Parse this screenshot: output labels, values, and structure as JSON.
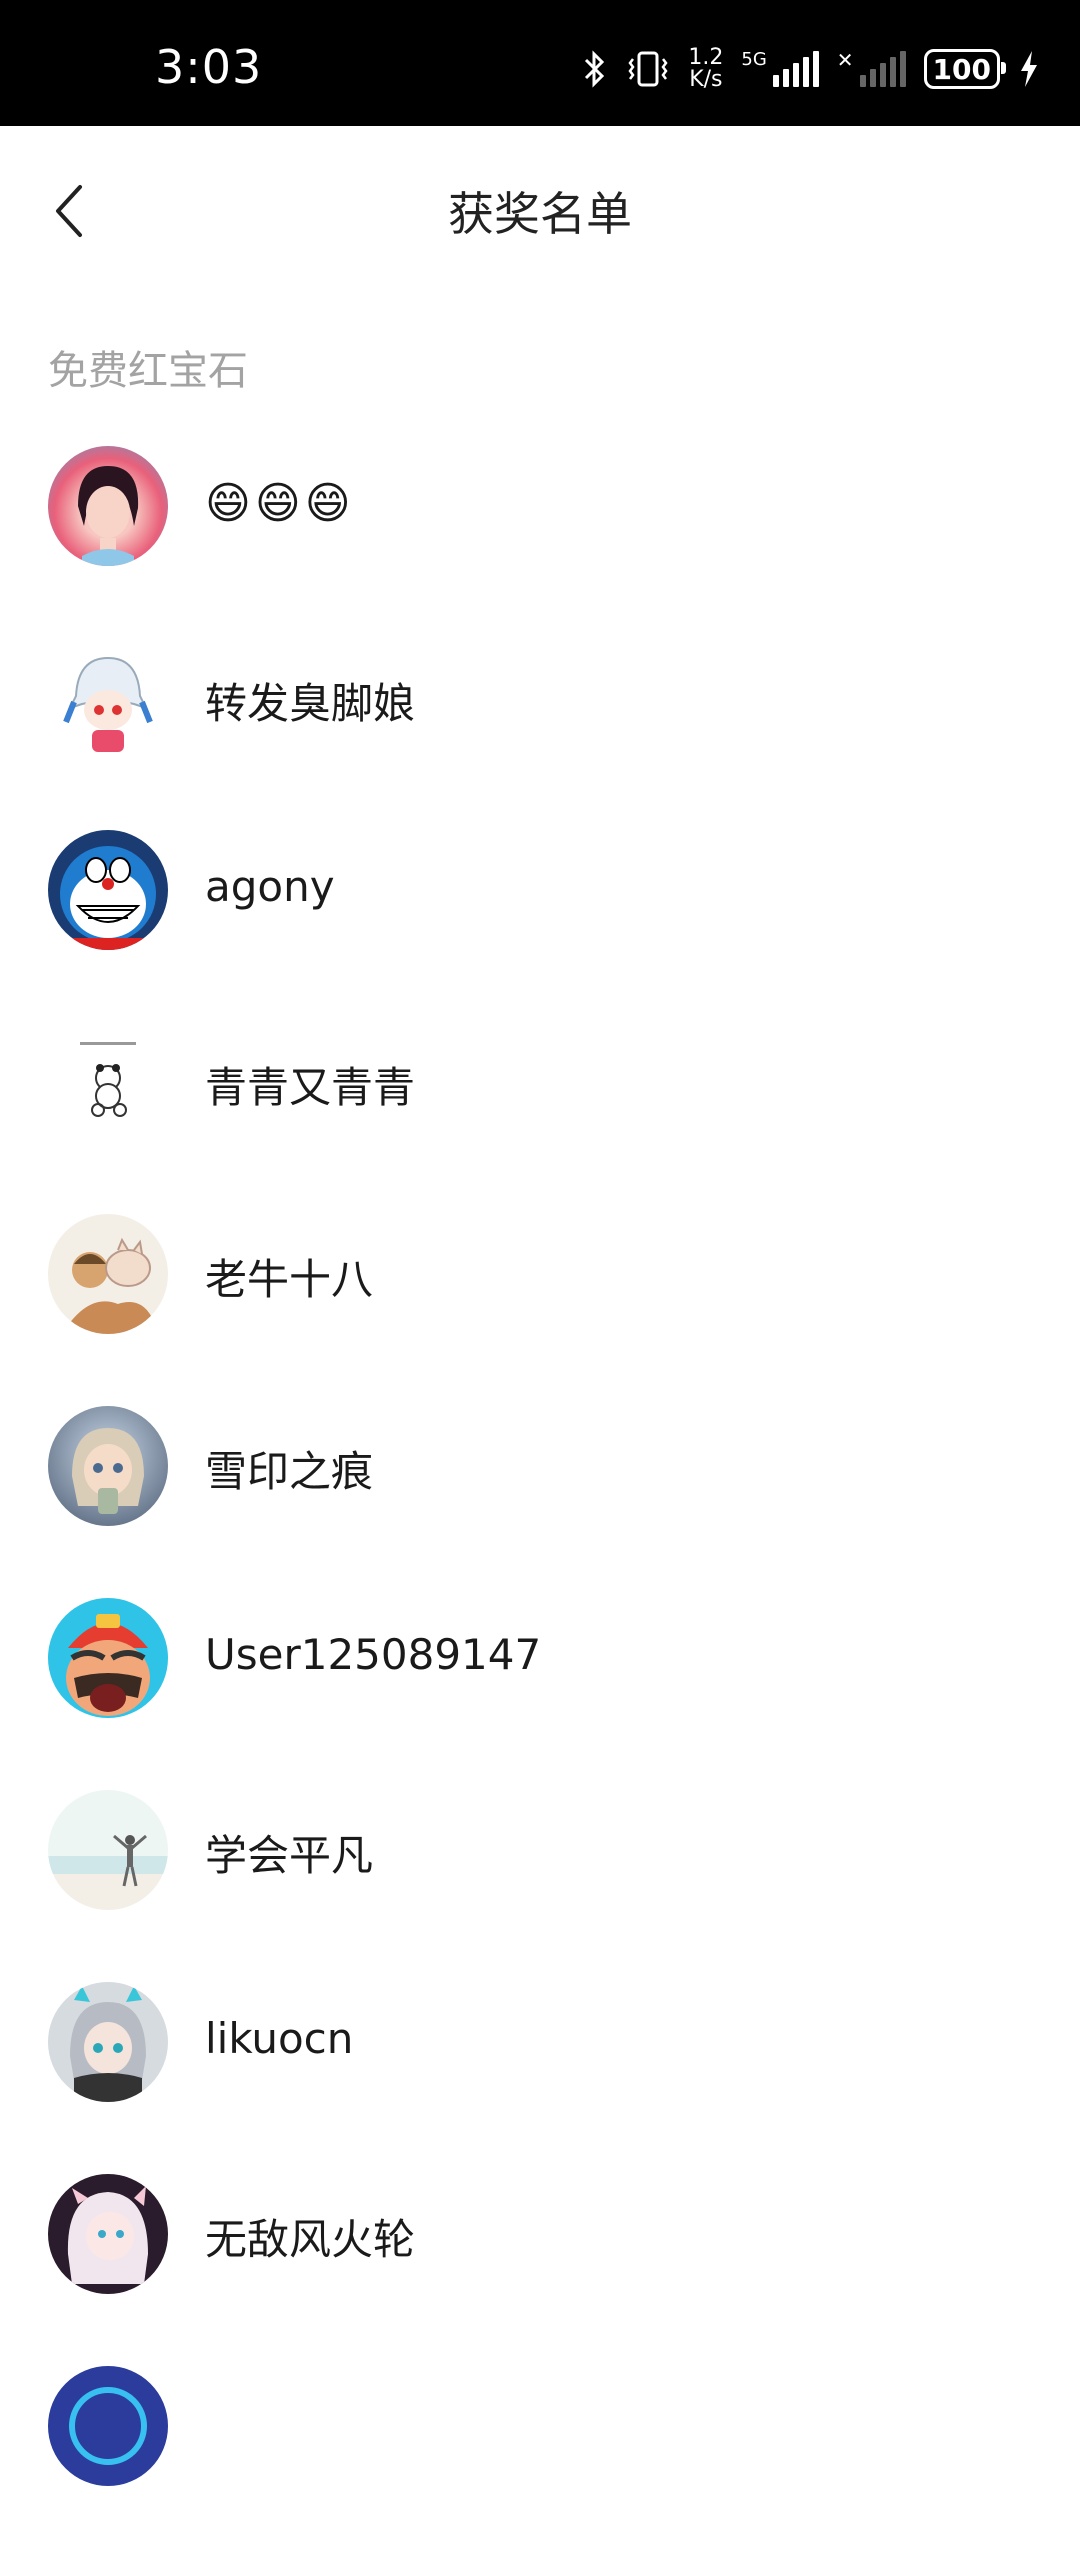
{
  "status_bar": {
    "time": "3:03",
    "net_speed_top": "1.2",
    "net_speed_bottom": "K/s",
    "network_type": "5G",
    "battery": "100"
  },
  "header": {
    "title": "获奖名单"
  },
  "section": {
    "title": "免费红宝石"
  },
  "winners": [
    {
      "name": "😄😄😄"
    },
    {
      "name": "转发臭脚娘"
    },
    {
      "name": "agony"
    },
    {
      "name": "青青又青青"
    },
    {
      "name": "老牛十八"
    },
    {
      "name": "雪印之痕"
    },
    {
      "name": "User125089147"
    },
    {
      "name": "学会平凡"
    },
    {
      "name": "likuocn"
    },
    {
      "name": "无敌风火轮"
    }
  ],
  "colors": {
    "status_bar_bg": "#000000",
    "section_title": "#a3a3a3",
    "text": "#1a1a1a"
  }
}
